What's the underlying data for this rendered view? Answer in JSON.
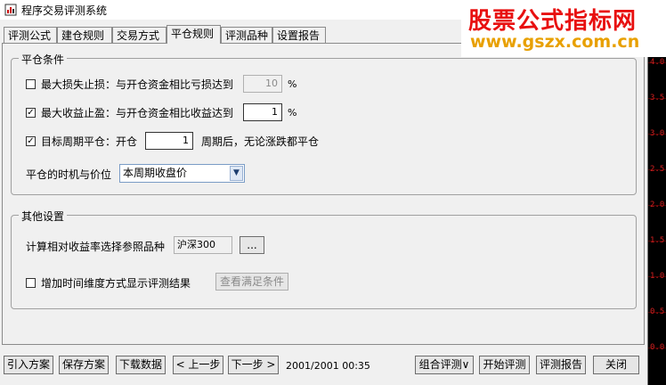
{
  "window": {
    "title": "程序交易评测系统"
  },
  "tabs": [
    {
      "label": "评测公式",
      "active": false
    },
    {
      "label": "建仓规则",
      "active": false
    },
    {
      "label": "交易方式",
      "active": false
    },
    {
      "label": "平仓规则",
      "active": true
    },
    {
      "label": "评测品种",
      "active": false
    },
    {
      "label": "设置报告",
      "active": false
    }
  ],
  "close_conditions": {
    "group_label": "平仓条件",
    "max_loss": {
      "label": "最大损失止损：与开仓资金相比亏损达到",
      "checked": false,
      "value": "10",
      "unit": "%"
    },
    "max_profit": {
      "label": "最大收益止盈：与开仓资金相比收益达到",
      "checked": true,
      "value": "1",
      "unit": "%"
    },
    "target_period": {
      "label": "目标周期平仓：开仓",
      "checked": true,
      "value": "1",
      "suffix": "周期后，无论涨跌都平仓"
    },
    "timing": {
      "label": "平仓的时机与价位",
      "selected": "本周期收盘价"
    }
  },
  "other_settings": {
    "group_label": "其他设置",
    "benchmark_label": "计算相对收益率选择参照品种",
    "benchmark_value": "沪深300",
    "browse_label": "...",
    "time_dim": {
      "label": "增加时间维度方式显示评测结果",
      "checked": false
    },
    "view_conditions_label": "查看满足条件"
  },
  "bottom": {
    "import_label": "引入方案",
    "save_label": "保存方案",
    "download_label": "下载数据",
    "prev_label": "< 上一步",
    "next_label": "下一步 >",
    "date_text": "2001/2001 00:35",
    "combo_label": "组合评测∨",
    "start_label": "开始评测",
    "report_label": "评测报告",
    "close_label": "关闭"
  },
  "watermark": {
    "line1": "股票公式指标网",
    "line2": "www.gszx.com.cn"
  },
  "right_strip": {
    "labels": [
      "4.0",
      "3.5",
      "3.0",
      "2.5",
      "2.0",
      "1.5",
      "1.0",
      "0.5",
      "0.0"
    ]
  },
  "colors": {
    "watermark_red": "#e81010",
    "watermark_orange": "#e8a000",
    "strip_text": "#d02020"
  }
}
